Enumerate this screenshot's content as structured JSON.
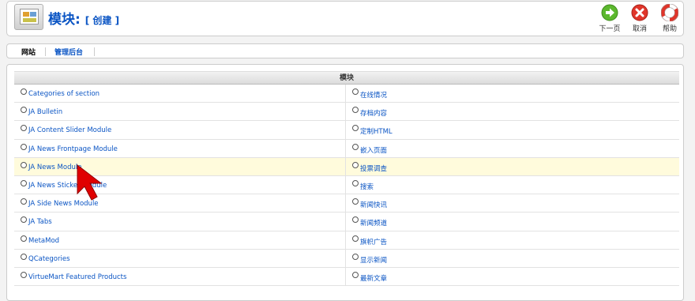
{
  "header": {
    "title": "模块:",
    "subtitle": "[ 创建 ]",
    "buttons": [
      {
        "label": "下一页",
        "icon": "next-arrow-icon",
        "color": "#5cb82e"
      },
      {
        "label": "取消",
        "icon": "cancel-x-icon",
        "color": "#e0352a"
      },
      {
        "label": "帮助",
        "icon": "help-lifebuoy-icon",
        "color": "#e0352a"
      }
    ]
  },
  "subnav": {
    "tabs": [
      {
        "label": "网站",
        "active": true
      },
      {
        "label": "管理后台",
        "active": false
      }
    ]
  },
  "modules": {
    "header": "模块",
    "rows": [
      {
        "left": "Categories of section",
        "right": "在线情况"
      },
      {
        "left": "JA Bulletin",
        "right": "存档内容"
      },
      {
        "left": "JA Content Slider Module",
        "right": "定制HTML"
      },
      {
        "left": "JA News Frontpage Module",
        "right": "嵌入页面"
      },
      {
        "left": "JA News Module",
        "right": "投票调查"
      },
      {
        "left": "JA News Sticker Module",
        "right": "搜索"
      },
      {
        "left": "JA Side News Module",
        "right": "新闻快讯"
      },
      {
        "left": "JA Tabs",
        "right": "新闻频道"
      },
      {
        "left": "MetaMod",
        "right": "旗帜广告"
      },
      {
        "left": "QCategories",
        "right": "显示新闻"
      },
      {
        "left": "VirtueMart Featured Products",
        "right": "最新文章"
      }
    ],
    "highlighted_row": 4
  },
  "colors": {
    "link": "#0b55c4",
    "highlight": "#fffbdc",
    "cursor": "#e00000"
  }
}
